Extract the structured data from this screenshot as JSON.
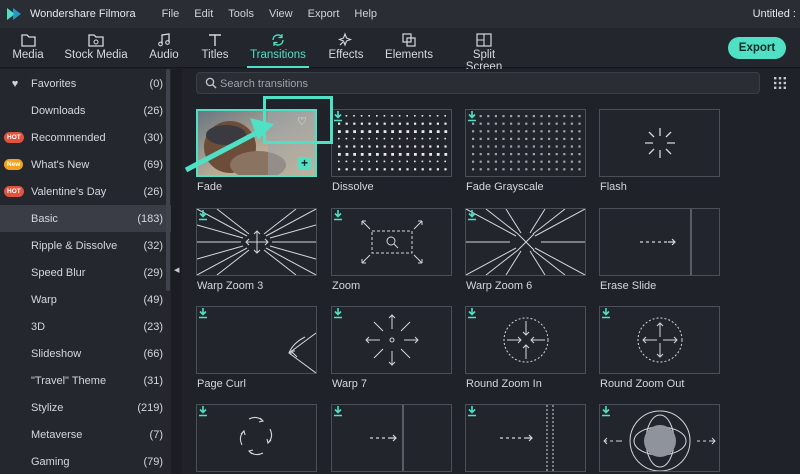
{
  "app": {
    "title": "Wondershare Filmora",
    "document_title": "Untitled :"
  },
  "menu": [
    "File",
    "Edit",
    "Tools",
    "View",
    "Export",
    "Help"
  ],
  "toolbar": {
    "tabs": [
      {
        "label": "Media",
        "icon": "folder-icon"
      },
      {
        "label": "Stock Media",
        "icon": "cloud-folder-icon"
      },
      {
        "label": "Audio",
        "icon": "music-note-icon"
      },
      {
        "label": "Titles",
        "icon": "text-t-icon"
      },
      {
        "label": "Transitions",
        "icon": "transition-icon",
        "active": true
      },
      {
        "label": "Effects",
        "icon": "sparkle-icon"
      },
      {
        "label": "Elements",
        "icon": "shapes-icon"
      },
      {
        "label": "Split Screen",
        "icon": "split-screen-icon"
      }
    ],
    "export_label": "Export"
  },
  "sidebar": {
    "items": [
      {
        "label": "Favorites",
        "count": "(0)",
        "icon": "heart-icon"
      },
      {
        "label": "Downloads",
        "count": "(26)"
      },
      {
        "label": "Recommended",
        "count": "(30)",
        "tag": "HOT"
      },
      {
        "label": "What's New",
        "count": "(69)",
        "tag": "New"
      },
      {
        "label": "Valentine's Day",
        "count": "(26)",
        "tag": "HOT"
      },
      {
        "label": "Basic",
        "count": "(183)",
        "active": true
      },
      {
        "label": "Ripple & Dissolve",
        "count": "(32)"
      },
      {
        "label": "Speed Blur",
        "count": "(29)"
      },
      {
        "label": "Warp",
        "count": "(49)"
      },
      {
        "label": "3D",
        "count": "(23)"
      },
      {
        "label": "Slideshow",
        "count": "(66)"
      },
      {
        "label": "\"Travel\" Theme",
        "count": "(31)"
      },
      {
        "label": "Stylize",
        "count": "(219)"
      },
      {
        "label": "Metaverse",
        "count": "(7)"
      },
      {
        "label": "Gaming",
        "count": "(79)"
      }
    ]
  },
  "search": {
    "placeholder": "Search transitions"
  },
  "transitions": [
    {
      "name": "Fade",
      "selected": true
    },
    {
      "name": "Dissolve"
    },
    {
      "name": "Fade Grayscale"
    },
    {
      "name": "Flash"
    },
    {
      "name": "Warp Zoom 3"
    },
    {
      "name": "Zoom"
    },
    {
      "name": "Warp Zoom 6"
    },
    {
      "name": "Erase Slide"
    },
    {
      "name": "Page Curl"
    },
    {
      "name": "Warp 7"
    },
    {
      "name": "Round Zoom In"
    },
    {
      "name": "Round Zoom Out"
    },
    {
      "name": ""
    },
    {
      "name": ""
    },
    {
      "name": ""
    },
    {
      "name": ""
    }
  ],
  "colors": {
    "accent": "#4fe0c5",
    "background": "#1c1f26",
    "hot_tag": "#e2533e",
    "new_tag": "#f0a21e"
  }
}
